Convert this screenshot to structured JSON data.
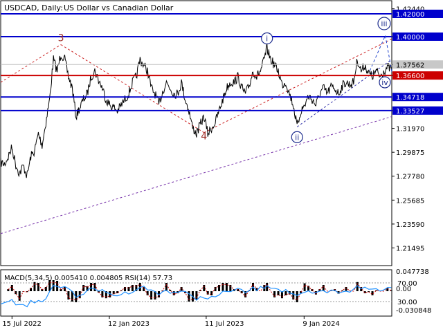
{
  "header": {
    "symbol": "USDCAD, Daily:",
    "description": "US Dollar vs Canadian Dollar"
  },
  "chart_data": [
    {
      "type": "line",
      "role": "price",
      "y_range": [
        1.1995,
        1.4315
      ],
      "y_ticks": [
        "1.42440",
        "1.40000",
        "1.37562",
        "1.36600",
        "1.33527",
        "1.31970",
        "1.29875",
        "1.27780",
        "1.25685",
        "1.23590",
        "1.21495"
      ],
      "x_range": [
        "2022-06-24",
        "2024-06-20"
      ],
      "x_labels": [
        {
          "date": "2022-07-15",
          "label": "15 Jul 2022"
        },
        {
          "date": "2023-01-12",
          "label": "12 Jan 2023"
        },
        {
          "date": "2023-07-11",
          "label": "11 Jul 2023"
        },
        {
          "date": "2024-01-09",
          "label": "9 Jan 2024"
        }
      ],
      "series": [
        {
          "points": [
            [
              "2022-06-24",
              1.29
            ],
            [
              "2022-07-01",
              1.288
            ],
            [
              "2022-07-08",
              1.295
            ],
            [
              "2022-07-15",
              1.303
            ],
            [
              "2022-07-22",
              1.288
            ],
            [
              "2022-07-29",
              1.28
            ],
            [
              "2022-08-05",
              1.287
            ],
            [
              "2022-08-12",
              1.278
            ],
            [
              "2022-08-19",
              1.295
            ],
            [
              "2022-08-26",
              1.3
            ],
            [
              "2022-09-02",
              1.315
            ],
            [
              "2022-09-09",
              1.305
            ],
            [
              "2022-09-16",
              1.325
            ],
            [
              "2022-09-23",
              1.345
            ],
            [
              "2022-09-30",
              1.38
            ],
            [
              "2022-10-07",
              1.37
            ],
            [
              "2022-10-14",
              1.385
            ],
            [
              "2022-10-21",
              1.38
            ],
            [
              "2022-10-28",
              1.365
            ],
            [
              "2022-11-04",
              1.355
            ],
            [
              "2022-11-11",
              1.33
            ],
            [
              "2022-11-18",
              1.338
            ],
            [
              "2022-11-25",
              1.345
            ],
            [
              "2022-12-02",
              1.35
            ],
            [
              "2022-12-09",
              1.365
            ],
            [
              "2022-12-16",
              1.37
            ],
            [
              "2022-12-23",
              1.362
            ],
            [
              "2022-12-30",
              1.355
            ],
            [
              "2023-01-06",
              1.345
            ],
            [
              "2023-01-13",
              1.34
            ],
            [
              "2023-01-20",
              1.338
            ],
            [
              "2023-01-27",
              1.335
            ],
            [
              "2023-02-03",
              1.34
            ],
            [
              "2023-02-10",
              1.345
            ],
            [
              "2023-02-17",
              1.35
            ],
            [
              "2023-02-24",
              1.36
            ],
            [
              "2023-03-03",
              1.365
            ],
            [
              "2023-03-10",
              1.38
            ],
            [
              "2023-03-17",
              1.375
            ],
            [
              "2023-03-24",
              1.37
            ],
            [
              "2023-03-31",
              1.355
            ],
            [
              "2023-04-07",
              1.35
            ],
            [
              "2023-04-14",
              1.34
            ],
            [
              "2023-04-21",
              1.352
            ],
            [
              "2023-04-28",
              1.36
            ],
            [
              "2023-05-05",
              1.355
            ],
            [
              "2023-05-12",
              1.35
            ],
            [
              "2023-05-19",
              1.35
            ],
            [
              "2023-05-26",
              1.36
            ],
            [
              "2023-06-02",
              1.345
            ],
            [
              "2023-06-09",
              1.335
            ],
            [
              "2023-06-16",
              1.32
            ],
            [
              "2023-06-23",
              1.315
            ],
            [
              "2023-06-30",
              1.323
            ],
            [
              "2023-07-07",
              1.33
            ],
            [
              "2023-07-14",
              1.315
            ],
            [
              "2023-07-21",
              1.32
            ],
            [
              "2023-07-28",
              1.325
            ],
            [
              "2023-08-04",
              1.335
            ],
            [
              "2023-08-11",
              1.345
            ],
            [
              "2023-08-18",
              1.355
            ],
            [
              "2023-08-25",
              1.36
            ],
            [
              "2023-09-01",
              1.36
            ],
            [
              "2023-09-08",
              1.365
            ],
            [
              "2023-09-15",
              1.355
            ],
            [
              "2023-09-22",
              1.35
            ],
            [
              "2023-09-29",
              1.357
            ],
            [
              "2023-10-06",
              1.37
            ],
            [
              "2023-10-13",
              1.365
            ],
            [
              "2023-10-20",
              1.37
            ],
            [
              "2023-10-27",
              1.38
            ],
            [
              "2023-11-01",
              1.39
            ],
            [
              "2023-11-08",
              1.38
            ],
            [
              "2023-11-15",
              1.375
            ],
            [
              "2023-11-22",
              1.37
            ],
            [
              "2023-11-29",
              1.358
            ],
            [
              "2023-12-06",
              1.36
            ],
            [
              "2023-12-13",
              1.35
            ],
            [
              "2023-12-20",
              1.34
            ],
            [
              "2023-12-27",
              1.321
            ],
            [
              "2024-01-03",
              1.335
            ],
            [
              "2024-01-10",
              1.34
            ],
            [
              "2024-01-17",
              1.348
            ],
            [
              "2024-01-24",
              1.345
            ],
            [
              "2024-01-31",
              1.34
            ],
            [
              "2024-02-07",
              1.35
            ],
            [
              "2024-02-14",
              1.355
            ],
            [
              "2024-02-21",
              1.35
            ],
            [
              "2024-02-28",
              1.356
            ],
            [
              "2024-03-06",
              1.355
            ],
            [
              "2024-03-13",
              1.35
            ],
            [
              "2024-03-20",
              1.357
            ],
            [
              "2024-03-27",
              1.36
            ],
            [
              "2024-04-03",
              1.358
            ],
            [
              "2024-04-10",
              1.36
            ],
            [
              "2024-04-17",
              1.38
            ],
            [
              "2024-04-24",
              1.37
            ],
            [
              "2024-05-01",
              1.375
            ],
            [
              "2024-05-08",
              1.368
            ],
            [
              "2024-05-15",
              1.365
            ],
            [
              "2024-05-22",
              1.37
            ],
            [
              "2024-05-29",
              1.365
            ],
            [
              "2024-06-05",
              1.37
            ],
            [
              "2024-06-12",
              1.373
            ],
            [
              "2024-06-19",
              1.372
            ]
          ]
        }
      ],
      "levels": [
        {
          "value": 1.42,
          "label": "1.42000",
          "color": "#0000cc"
        },
        {
          "value": 1.4,
          "label": "1.40000",
          "color": "#0000cc"
        },
        {
          "value": 1.366,
          "label": "1.36600",
          "color": "#cc0000"
        },
        {
          "value": 1.34718,
          "label": "1.34718",
          "color": "#0000cc"
        },
        {
          "value": 1.33527,
          "label": "1.33527",
          "color": "#0000cc"
        }
      ],
      "current_price": "1.37562",
      "wave_labels": [
        {
          "label": "3",
          "date": "2022-10-14",
          "value": 1.396,
          "color": "#a0302a",
          "style": "plain"
        },
        {
          "label": "4",
          "date": "2023-07-07",
          "value": 1.31,
          "color": "#a0302a",
          "style": "plain"
        },
        {
          "label": "i",
          "date": "2023-11-01",
          "value": 1.3985,
          "color": "#1a2a8c",
          "style": "circled"
        },
        {
          "label": "ii",
          "date": "2023-12-27",
          "value": 1.312,
          "color": "#1a2a8c",
          "style": "circled"
        },
        {
          "label": "iii",
          "date": "2024-06-20",
          "value": 1.4115,
          "color": "#1a2a8c",
          "style": "circled"
        },
        {
          "label": "iv",
          "date": "2024-06-20",
          "value": 1.36,
          "color": "#1a2a8c",
          "style": "circled"
        }
      ],
      "trend_lines": [
        {
          "points": [
            [
              "2022-06-24",
              1.36
            ],
            [
              "2022-10-14",
              1.393
            ]
          ],
          "color": "#cc2222"
        },
        {
          "points": [
            [
              "2022-10-14",
              1.393
            ],
            [
              "2023-07-07",
              1.316
            ]
          ],
          "color": "#cc2222"
        },
        {
          "points": [
            [
              "2023-07-07",
              1.316
            ],
            [
              "2024-06-20",
              1.398
            ]
          ],
          "color": "#cc2222"
        },
        {
          "points": [
            [
              "2023-12-27",
              1.321
            ],
            [
              "2024-06-20",
              1.38
            ]
          ],
          "color": "#3333aa"
        },
        {
          "points": [
            [
              "2022-06-24",
              1.2275
            ],
            [
              "2024-06-20",
              1.33
            ]
          ],
          "color": "#7733aa"
        }
      ],
      "projection": {
        "points": [
          [
            "2024-05-10",
            1.37
          ],
          [
            "2024-06-08",
            1.401
          ],
          [
            "2024-06-16",
            1.38
          ],
          [
            "2024-06-20",
            1.369
          ]
        ],
        "color": "#2244cc"
      },
      "colors": {
        "price_line": "#000000",
        "background": "#ffffff",
        "current_price_tag": "#c8c8c8"
      }
    },
    {
      "type": "bar",
      "role": "indicator",
      "indicator_label": "MACD(5,34,5) 0.005410 0.004805 RSI(14) 57.73",
      "left_ticks": [
        "0.047738",
        "0.00",
        "-0.030848"
      ],
      "right_ticks": [
        "70.00",
        "30.00"
      ],
      "colors": {
        "macd_bars": "#000000",
        "rsi_line": "#1e90ff",
        "macd_signal": "#cc0000"
      }
    }
  ]
}
